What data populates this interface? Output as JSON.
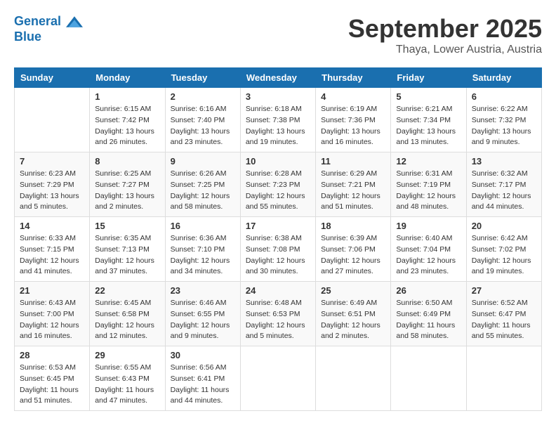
{
  "header": {
    "logo_line1": "General",
    "logo_line2": "Blue",
    "month": "September 2025",
    "location": "Thaya, Lower Austria, Austria"
  },
  "days_of_week": [
    "Sunday",
    "Monday",
    "Tuesday",
    "Wednesday",
    "Thursday",
    "Friday",
    "Saturday"
  ],
  "weeks": [
    [
      {
        "day": "",
        "info": ""
      },
      {
        "day": "1",
        "info": "Sunrise: 6:15 AM\nSunset: 7:42 PM\nDaylight: 13 hours\nand 26 minutes."
      },
      {
        "day": "2",
        "info": "Sunrise: 6:16 AM\nSunset: 7:40 PM\nDaylight: 13 hours\nand 23 minutes."
      },
      {
        "day": "3",
        "info": "Sunrise: 6:18 AM\nSunset: 7:38 PM\nDaylight: 13 hours\nand 19 minutes."
      },
      {
        "day": "4",
        "info": "Sunrise: 6:19 AM\nSunset: 7:36 PM\nDaylight: 13 hours\nand 16 minutes."
      },
      {
        "day": "5",
        "info": "Sunrise: 6:21 AM\nSunset: 7:34 PM\nDaylight: 13 hours\nand 13 minutes."
      },
      {
        "day": "6",
        "info": "Sunrise: 6:22 AM\nSunset: 7:32 PM\nDaylight: 13 hours\nand 9 minutes."
      }
    ],
    [
      {
        "day": "7",
        "info": "Sunrise: 6:23 AM\nSunset: 7:29 PM\nDaylight: 13 hours\nand 5 minutes."
      },
      {
        "day": "8",
        "info": "Sunrise: 6:25 AM\nSunset: 7:27 PM\nDaylight: 13 hours\nand 2 minutes."
      },
      {
        "day": "9",
        "info": "Sunrise: 6:26 AM\nSunset: 7:25 PM\nDaylight: 12 hours\nand 58 minutes."
      },
      {
        "day": "10",
        "info": "Sunrise: 6:28 AM\nSunset: 7:23 PM\nDaylight: 12 hours\nand 55 minutes."
      },
      {
        "day": "11",
        "info": "Sunrise: 6:29 AM\nSunset: 7:21 PM\nDaylight: 12 hours\nand 51 minutes."
      },
      {
        "day": "12",
        "info": "Sunrise: 6:31 AM\nSunset: 7:19 PM\nDaylight: 12 hours\nand 48 minutes."
      },
      {
        "day": "13",
        "info": "Sunrise: 6:32 AM\nSunset: 7:17 PM\nDaylight: 12 hours\nand 44 minutes."
      }
    ],
    [
      {
        "day": "14",
        "info": "Sunrise: 6:33 AM\nSunset: 7:15 PM\nDaylight: 12 hours\nand 41 minutes."
      },
      {
        "day": "15",
        "info": "Sunrise: 6:35 AM\nSunset: 7:13 PM\nDaylight: 12 hours\nand 37 minutes."
      },
      {
        "day": "16",
        "info": "Sunrise: 6:36 AM\nSunset: 7:10 PM\nDaylight: 12 hours\nand 34 minutes."
      },
      {
        "day": "17",
        "info": "Sunrise: 6:38 AM\nSunset: 7:08 PM\nDaylight: 12 hours\nand 30 minutes."
      },
      {
        "day": "18",
        "info": "Sunrise: 6:39 AM\nSunset: 7:06 PM\nDaylight: 12 hours\nand 27 minutes."
      },
      {
        "day": "19",
        "info": "Sunrise: 6:40 AM\nSunset: 7:04 PM\nDaylight: 12 hours\nand 23 minutes."
      },
      {
        "day": "20",
        "info": "Sunrise: 6:42 AM\nSunset: 7:02 PM\nDaylight: 12 hours\nand 19 minutes."
      }
    ],
    [
      {
        "day": "21",
        "info": "Sunrise: 6:43 AM\nSunset: 7:00 PM\nDaylight: 12 hours\nand 16 minutes."
      },
      {
        "day": "22",
        "info": "Sunrise: 6:45 AM\nSunset: 6:58 PM\nDaylight: 12 hours\nand 12 minutes."
      },
      {
        "day": "23",
        "info": "Sunrise: 6:46 AM\nSunset: 6:55 PM\nDaylight: 12 hours\nand 9 minutes."
      },
      {
        "day": "24",
        "info": "Sunrise: 6:48 AM\nSunset: 6:53 PM\nDaylight: 12 hours\nand 5 minutes."
      },
      {
        "day": "25",
        "info": "Sunrise: 6:49 AM\nSunset: 6:51 PM\nDaylight: 12 hours\nand 2 minutes."
      },
      {
        "day": "26",
        "info": "Sunrise: 6:50 AM\nSunset: 6:49 PM\nDaylight: 11 hours\nand 58 minutes."
      },
      {
        "day": "27",
        "info": "Sunrise: 6:52 AM\nSunset: 6:47 PM\nDaylight: 11 hours\nand 55 minutes."
      }
    ],
    [
      {
        "day": "28",
        "info": "Sunrise: 6:53 AM\nSunset: 6:45 PM\nDaylight: 11 hours\nand 51 minutes."
      },
      {
        "day": "29",
        "info": "Sunrise: 6:55 AM\nSunset: 6:43 PM\nDaylight: 11 hours\nand 47 minutes."
      },
      {
        "day": "30",
        "info": "Sunrise: 6:56 AM\nSunset: 6:41 PM\nDaylight: 11 hours\nand 44 minutes."
      },
      {
        "day": "",
        "info": ""
      },
      {
        "day": "",
        "info": ""
      },
      {
        "day": "",
        "info": ""
      },
      {
        "day": "",
        "info": ""
      }
    ]
  ]
}
